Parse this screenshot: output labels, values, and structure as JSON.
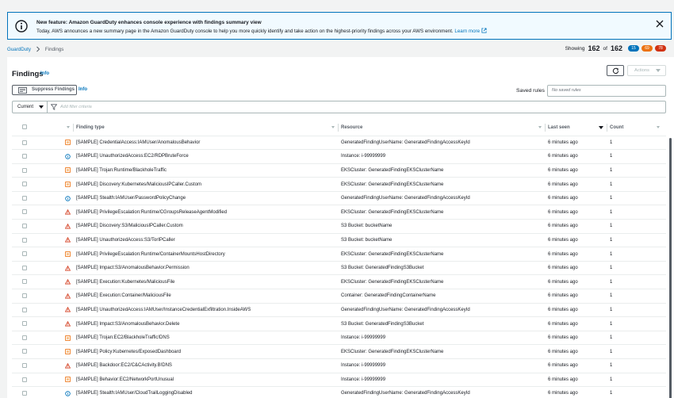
{
  "banner": {
    "title": "New feature: Amazon GuardDuty enhances console experience with findings summary view",
    "body": "Today, AWS announces a new summary page in the Amazon GuardDuty console to help you more quickly identify and take action on the highest-priority findings across your AWS environment.",
    "link": "Learn more"
  },
  "breadcrumb": {
    "root": "GuardDuty",
    "current": "Findings"
  },
  "showing": {
    "label": "Showing",
    "shown": "162",
    "of": "of",
    "total": "162",
    "low": "15",
    "medium": "69",
    "high": "78"
  },
  "colors": {
    "low": "#0073bb",
    "medium": "#ec7211",
    "high": "#d13212",
    "link": "#0073bb"
  },
  "header": {
    "title": "Findings",
    "info": "Info",
    "actions": "Actions"
  },
  "toolbar": {
    "suppress": "Suppress Findings",
    "info": "Info",
    "saved_rules_label": "Saved rules",
    "saved_rules_placeholder": "No saved rules"
  },
  "filter": {
    "select": "Current",
    "placeholder": "Add filter criteria"
  },
  "columns": {
    "type": "Finding type",
    "resource": "Resource",
    "last_seen": "Last seen",
    "count": "Count"
  },
  "rows": [
    {
      "sev": "medium",
      "type": "[SAMPLE] CredentialAccess:IAMUser/AnomalousBehavior",
      "resource": "GeneratedFindingUserName: GeneratedFindingAccessKeyId",
      "seen": "6 minutes ago",
      "count": "1"
    },
    {
      "sev": "low",
      "type": "[SAMPLE] UnauthorizedAccess:EC2/RDPBruteForce",
      "resource": "Instance: i-99999999",
      "seen": "6 minutes ago",
      "count": "1"
    },
    {
      "sev": "medium",
      "type": "[SAMPLE] Trojan:Runtime/BlackholeTraffic",
      "resource": "EKSCluster: GeneratedFindingEKSClusterName",
      "seen": "6 minutes ago",
      "count": "1"
    },
    {
      "sev": "medium",
      "type": "[SAMPLE] Discovery:Kubernetes/MaliciousIPCaller.Custom",
      "resource": "EKSCluster: GeneratedFindingEKSClusterName",
      "seen": "6 minutes ago",
      "count": "1"
    },
    {
      "sev": "low",
      "type": "[SAMPLE] Stealth:IAMUser/PasswordPolicyChange",
      "resource": "GeneratedFindingUserName: GeneratedFindingAccessKeyId",
      "seen": "6 minutes ago",
      "count": "1"
    },
    {
      "sev": "high",
      "type": "[SAMPLE] PrivilegeEscalation:Runtime/CGroupsReleaseAgentModified",
      "resource": "EKSCluster: GeneratedFindingEKSClusterName",
      "seen": "6 minutes ago",
      "count": "1"
    },
    {
      "sev": "high",
      "type": "[SAMPLE] Discovery:S3/MaliciousIPCaller.Custom",
      "resource": "S3 Bucket: bucketName",
      "seen": "6 minutes ago",
      "count": "1"
    },
    {
      "sev": "high",
      "type": "[SAMPLE] UnauthorizedAccess:S3/TorIPCaller",
      "resource": "S3 Bucket: bucketName",
      "seen": "6 minutes ago",
      "count": "1"
    },
    {
      "sev": "medium",
      "type": "[SAMPLE] PrivilegeEscalation:Runtime/ContainerMountsHostDirectory",
      "resource": "EKSCluster: GeneratedFindingEKSClusterName",
      "seen": "6 minutes ago",
      "count": "1"
    },
    {
      "sev": "high",
      "type": "[SAMPLE] Impact:S3/AnomalousBehavior.Permission",
      "resource": "S3 Bucket: GeneratedFindingS3Bucket",
      "seen": "6 minutes ago",
      "count": "1"
    },
    {
      "sev": "high",
      "type": "[SAMPLE] Execution:Kubernetes/MaliciousFile",
      "resource": "EKSCluster: GeneratedFindingEKSClusterName",
      "seen": "6 minutes ago",
      "count": "1"
    },
    {
      "sev": "high",
      "type": "[SAMPLE] Execution:Container/MaliciousFile",
      "resource": "Container: GeneratedFindingContainerName",
      "seen": "6 minutes ago",
      "count": "1"
    },
    {
      "sev": "high",
      "type": "[SAMPLE] UnauthorizedAccess:IAMUser/InstanceCredentialExfiltration.InsideAWS",
      "resource": "GeneratedFindingUserName: GeneratedFindingAccessKeyId",
      "seen": "6 minutes ago",
      "count": "1"
    },
    {
      "sev": "high",
      "type": "[SAMPLE] Impact:S3/AnomalousBehavior.Delete",
      "resource": "S3 Bucket: GeneratedFindingS3Bucket",
      "seen": "6 minutes ago",
      "count": "1"
    },
    {
      "sev": "medium",
      "type": "[SAMPLE] Trojan:EC2/BlackholeTraffic!DNS",
      "resource": "Instance: i-99999999",
      "seen": "6 minutes ago",
      "count": "1"
    },
    {
      "sev": "medium",
      "type": "[SAMPLE] Policy:Kubernetes/ExposedDashboard",
      "resource": "EKSCluster: GeneratedFindingEKSClusterName",
      "seen": "6 minutes ago",
      "count": "1"
    },
    {
      "sev": "high",
      "type": "[SAMPLE] Backdoor:EC2/C&CActivity.B!DNS",
      "resource": "Instance: i-99999999",
      "seen": "6 minutes ago",
      "count": "1"
    },
    {
      "sev": "medium",
      "type": "[SAMPLE] Behavior:EC2/NetworkPortUnusual",
      "resource": "Instance: i-99999999",
      "seen": "6 minutes ago",
      "count": "1"
    },
    {
      "sev": "low",
      "type": "[SAMPLE] Stealth:IAMUser/CloudTrailLoggingDisabled",
      "resource": "GeneratedFindingUserName: GeneratedFindingAccessKeyId",
      "seen": "6 minutes ago",
      "count": "1"
    }
  ]
}
